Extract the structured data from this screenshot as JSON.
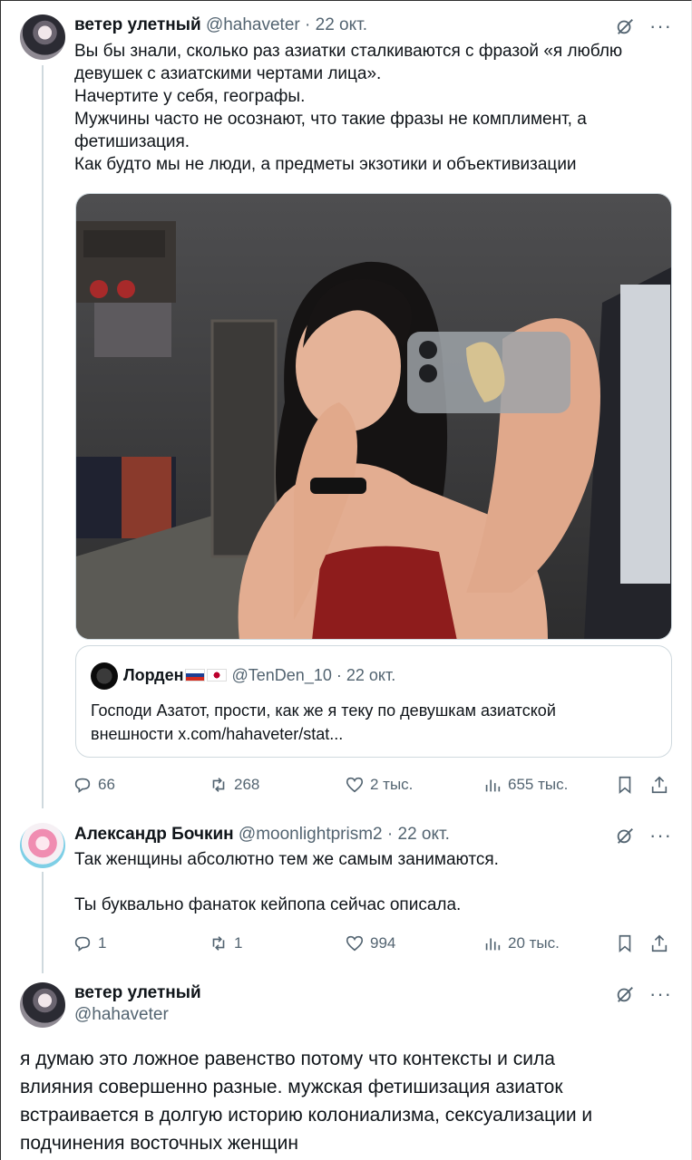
{
  "tweet1": {
    "name": "ветер улетный",
    "handle": "@hahaveter",
    "dot": "·",
    "date": "22 окт.",
    "lines": [
      "Вы бы знали, сколько раз азиатки сталкиваются с фразой «я люблю",
      "девушек с азиатскими чертами лица».",
      "Начертите у себя, географы.",
      "Мужчины часто не осознают, что такие фразы не комплимент, а",
      "фетишизация.",
      "Как будто мы не люди, а предметы экзотики и объективизации"
    ],
    "quote": {
      "name": "Лорден",
      "handle": "@TenDen_10",
      "dot": "·",
      "date": "22 окт.",
      "lines": [
        "Господи Азатот, прости, как же я теку по девушкам азиатской",
        "внешности x.com/hahaveter/stat..."
      ]
    },
    "actions": {
      "replies": "66",
      "reposts": "268",
      "likes": "2 тыс.",
      "views": "655 тыс."
    }
  },
  "tweet2": {
    "name": "Александр Бочкин",
    "handle": "@moonlightprism2",
    "dot": "·",
    "date": "22 окт.",
    "line1": "Так женщины абсолютно тем же самым занимаются.",
    "line2": "Ты буквально фанаток кейпопа сейчас описала.",
    "actions": {
      "replies": "1",
      "reposts": "1",
      "likes": "994",
      "views": "20 тыс."
    }
  },
  "tweet3": {
    "name": "ветер улетный",
    "handle": "@hahaveter",
    "lines": [
      "я думаю это ложное равенство потому что контексты и сила",
      "влияния совершенно разные. мужская фетишизация азиаток",
      "встраивается в долгую историю колониализма, сексуализации и",
      "подчинения восточных женщин"
    ]
  },
  "icons": {
    "more": "···",
    "grok": "grok-icon"
  }
}
